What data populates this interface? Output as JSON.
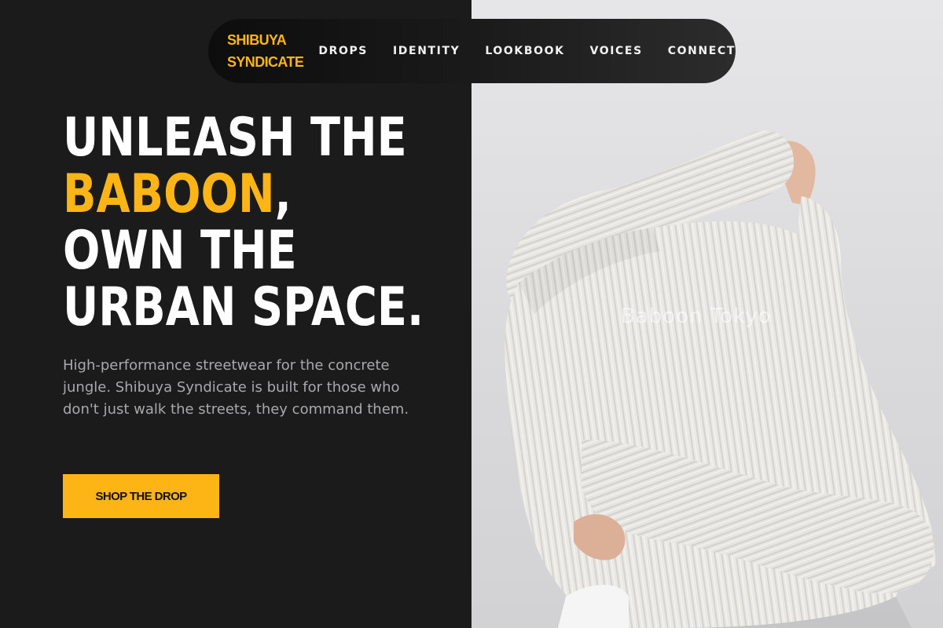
{
  "brand": {
    "line1": "SHIBUYA",
    "line2": "SYNDICATE"
  },
  "nav": {
    "items": [
      {
        "label": "DROPS"
      },
      {
        "label": "IDENTITY"
      },
      {
        "label": "LOOKBOOK"
      },
      {
        "label": "VOICES"
      },
      {
        "label": "CONNECT"
      }
    ]
  },
  "hero": {
    "line1": "UNLEASH THE",
    "accent_word": "BABOON",
    "accent_suffix": ",",
    "line3": "OWN THE",
    "line4": "URBAN SPACE.",
    "description": "High-performance streetwear for the concrete jungle. Shibuya Syndicate is built for those who don't just walk the streets, they command them.",
    "cta_label": "SHOP THE DROP"
  },
  "image": {
    "watermark": "Baboon Tokyo",
    "subject_icon": "sweater-photo"
  },
  "colors": {
    "accent": "#fdb515",
    "background": "#1b1b1c",
    "text": "#ffffff",
    "muted": "#a9a9ad"
  }
}
